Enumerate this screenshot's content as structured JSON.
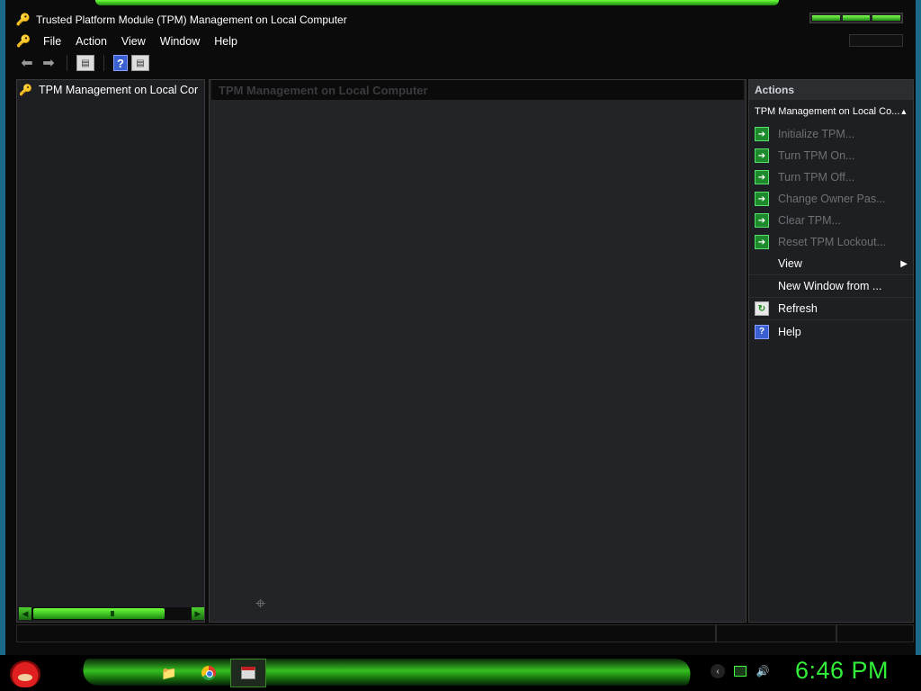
{
  "window": {
    "title": "Trusted Platform Module (TPM) Management on Local Computer"
  },
  "menubar": {
    "items": [
      {
        "label": "File"
      },
      {
        "label": "Action"
      },
      {
        "label": "View"
      },
      {
        "label": "Window"
      },
      {
        "label": "Help"
      }
    ]
  },
  "toolbar": {
    "buttons": [
      "back-icon",
      "forward-icon",
      "show-hide-console-tree-icon",
      "help-icon",
      "show-hide-action-pane-icon"
    ]
  },
  "tree": {
    "root_label": "TPM Management on Local Cor"
  },
  "center": {
    "header": "TPM Management on Local Computer"
  },
  "actions": {
    "header": "Actions",
    "section": "TPM Management on Local Co...",
    "items": [
      {
        "label": "Initialize TPM...",
        "enabled": false,
        "icon": "green-arrow-icon"
      },
      {
        "label": "Turn TPM On...",
        "enabled": false,
        "icon": "green-arrow-icon"
      },
      {
        "label": "Turn TPM Off...",
        "enabled": false,
        "icon": "green-arrow-icon"
      },
      {
        "label": "Change Owner Pas...",
        "enabled": false,
        "icon": "green-arrow-icon"
      },
      {
        "label": "Clear TPM...",
        "enabled": false,
        "icon": "green-arrow-icon"
      },
      {
        "label": "Reset TPM Lockout...",
        "enabled": false,
        "icon": "green-arrow-icon"
      },
      {
        "label": "View",
        "enabled": true,
        "icon": "",
        "submenu": true
      },
      {
        "label": "New Window from ...",
        "enabled": true,
        "icon": ""
      },
      {
        "label": "Refresh",
        "enabled": true,
        "icon": "refresh-icon"
      },
      {
        "label": "Help",
        "enabled": true,
        "icon": "help-icon"
      }
    ]
  },
  "taskbar": {
    "clock": "6:46 PM",
    "accent": "#32f03a"
  }
}
